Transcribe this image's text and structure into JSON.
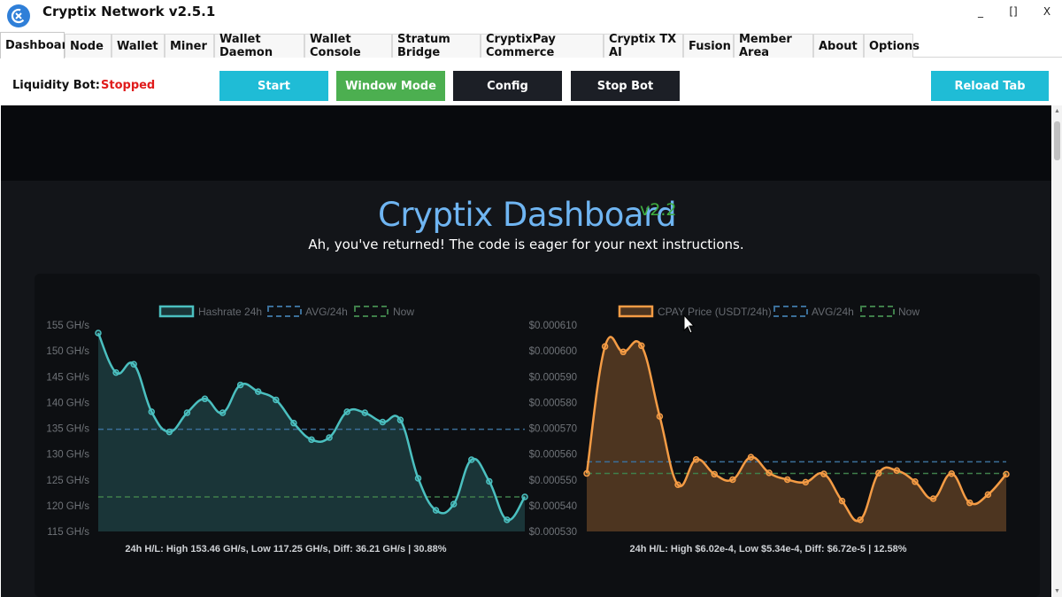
{
  "window": {
    "title": "Cryptix Network v2.5.1",
    "minimize": "_",
    "maximize": "[]",
    "close": "X"
  },
  "tabs": [
    "Dashboard",
    "Node",
    "Wallet",
    "Miner",
    "Wallet Daemon",
    "Wallet Console",
    "Stratum Bridge",
    "CryptixPay Commerce",
    "Cryptix TX AI",
    "Fusion",
    "Member Area",
    "About",
    "Options"
  ],
  "toolbar": {
    "bot_label": "Liquidity Bot:",
    "bot_status": "Stopped",
    "start": "Start",
    "window_mode": "Window Mode",
    "config": "Config",
    "stop_bot": "Stop Bot",
    "reload_tab": "Reload Tab"
  },
  "dashboard": {
    "title": "Cryptix Dashboard",
    "version": "v2.2",
    "subtitle": "Ah, you've returned! The code is eager for your next instructions."
  },
  "colors": {
    "hashrate": "#4bc0c0",
    "price": "#f59c45",
    "avg_line": "#3b6f99",
    "now_line": "#3f7f4a",
    "accent_cyan": "#1fbcd6",
    "accent_green": "#4caf50",
    "status_red": "#e01b1b"
  },
  "chart_data": [
    {
      "type": "line",
      "legend": [
        "Hashrate 24h",
        "AVG/24h",
        "Now"
      ],
      "ylabels": [
        "155 GH/s",
        "150 GH/s",
        "145 GH/s",
        "140 GH/s",
        "135 GH/s",
        "130 GH/s",
        "125 GH/s",
        "120 GH/s",
        "115 GH/s"
      ],
      "ylim": [
        115,
        155
      ],
      "values": [
        153.46,
        145.8,
        147.4,
        138.2,
        134.3,
        138.0,
        140.7,
        138.0,
        143.4,
        142.1,
        140.5,
        136.0,
        132.8,
        133.2,
        138.2,
        138.0,
        136.2,
        136.6,
        125.3,
        119.1,
        120.3,
        128.9,
        124.7,
        117.25,
        121.7
      ],
      "avg": 134.8,
      "now": 121.7,
      "footer": "24h H/L: High 153.46 GH/s, Low 117.25 GH/s, Diff: 36.21 GH/s | 30.88%"
    },
    {
      "type": "line",
      "legend": [
        "CPAY Price (USDT/24h)",
        "AVG/24h",
        "Now"
      ],
      "ylabels": [
        "$0.000610",
        "$0.000600",
        "$0.000590",
        "$0.000580",
        "$0.000570",
        "$0.000560",
        "$0.000550",
        "$0.000540",
        "$0.000530"
      ],
      "ylim": [
        0.00053,
        0.00061
      ],
      "values": [
        0.0005525,
        0.0006017,
        0.0005996,
        0.000602,
        0.0005746,
        0.0005481,
        0.0005579,
        0.0005522,
        0.0005501,
        0.0005588,
        0.0005527,
        0.0005501,
        0.0005491,
        0.0005523,
        0.0005418,
        0.0005345,
        0.0005526,
        0.0005536,
        0.0005493,
        0.0005427,
        0.0005524,
        0.0005411,
        0.0005443,
        0.0005522
      ],
      "avg": 0.000557,
      "now": 0.0005525,
      "footer": "24h H/L: High $6.02e-4, Low $5.34e-4, Diff: $6.72e-5 | 12.58%"
    }
  ]
}
